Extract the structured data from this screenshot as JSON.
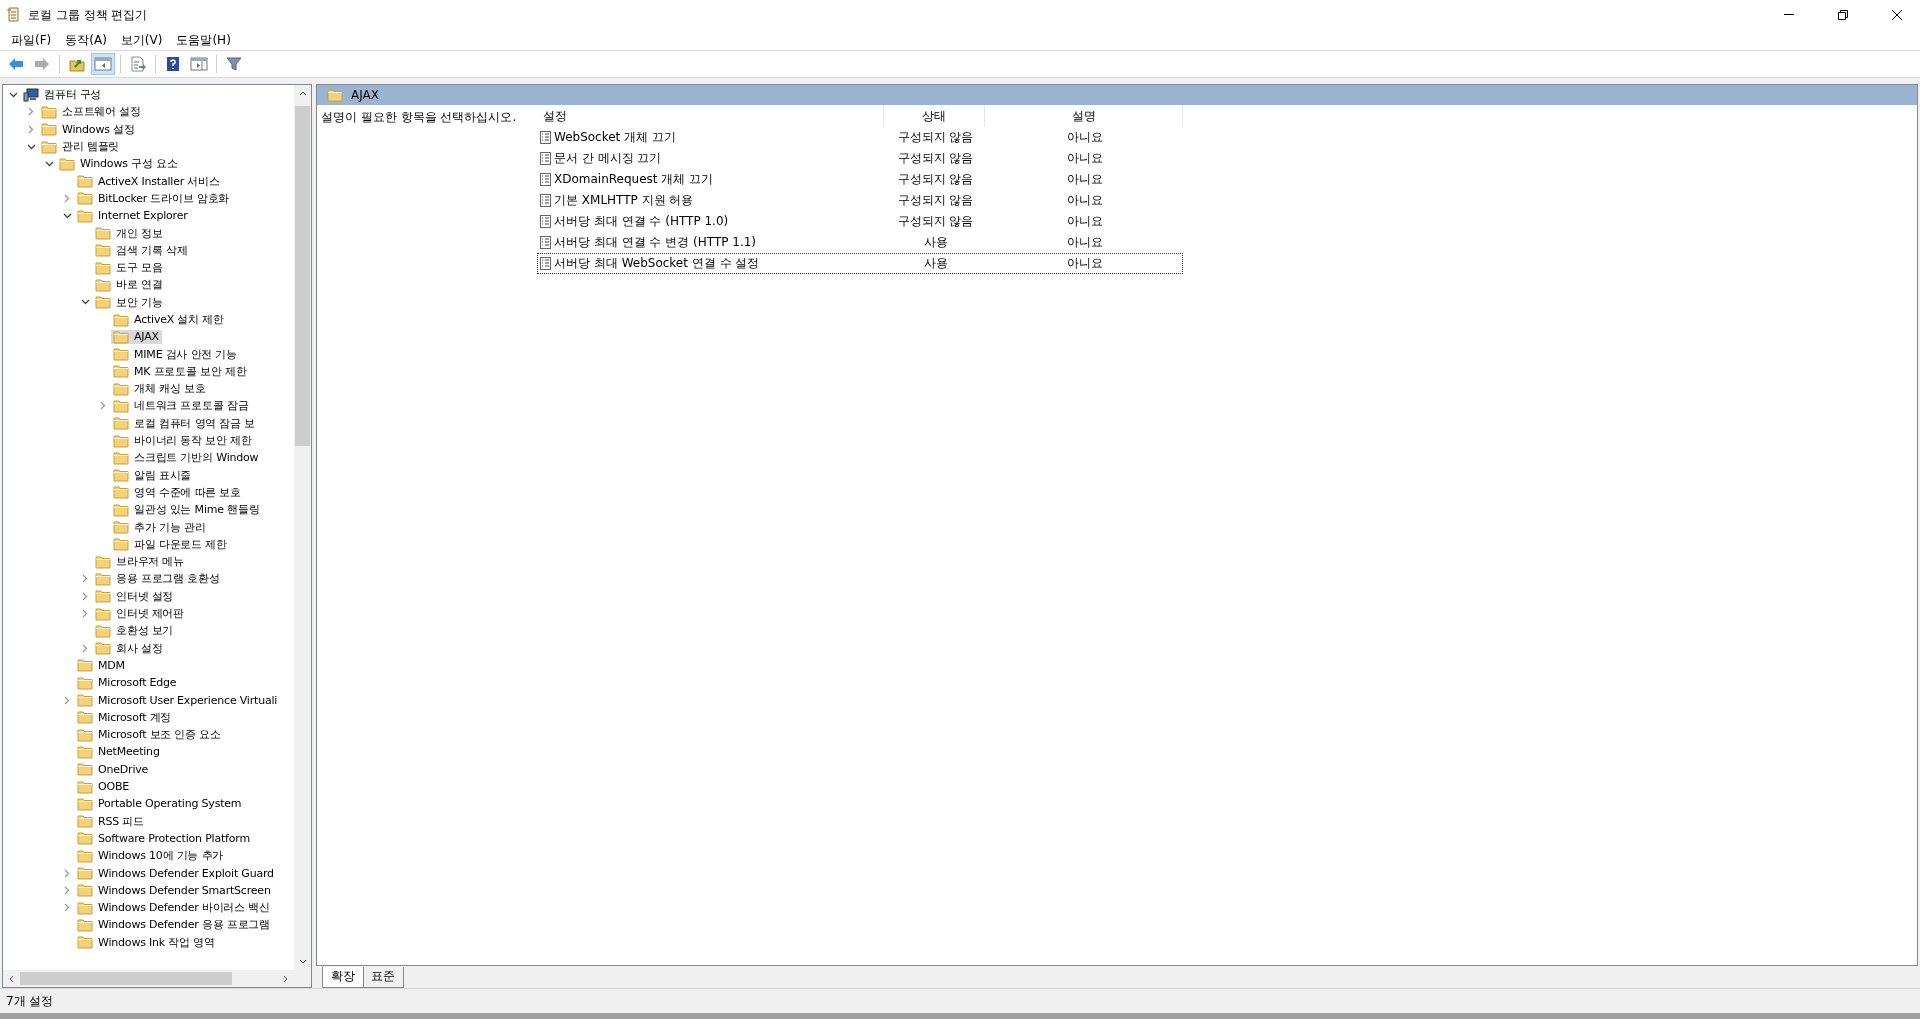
{
  "window": {
    "title": "로컬 그룹 정책 편집기"
  },
  "menu": [
    "파일(F)",
    "동작(A)",
    "보기(V)",
    "도움말(H)"
  ],
  "toolbar": [
    {
      "kind": "back",
      "disabled": false,
      "pressed": false
    },
    {
      "kind": "forward",
      "disabled": true,
      "pressed": false
    },
    {
      "kind": "up",
      "disabled": false,
      "pressed": false
    },
    {
      "kind": "tree",
      "disabled": false,
      "pressed": true
    },
    {
      "kind": "export",
      "disabled": false,
      "pressed": false
    },
    {
      "kind": "help",
      "disabled": false,
      "pressed": false
    },
    {
      "kind": "pane",
      "disabled": false,
      "pressed": false
    },
    {
      "kind": "filter",
      "disabled": false,
      "pressed": false
    }
  ],
  "tree": [
    {
      "label": "컴퓨터 구성",
      "kind": "computer",
      "expanded": true,
      "selected": false,
      "children": [
        {
          "label": "소프트웨어 설정",
          "expanded": false,
          "selected": false
        },
        {
          "label": "Windows 설정",
          "expanded": false,
          "selected": false
        },
        {
          "label": "관리 템플릿",
          "expanded": true,
          "selected": false,
          "children": [
            {
              "label": "Windows 구성 요소",
              "expanded": true,
              "selected": false,
              "children": [
                {
                  "label": "ActiveX Installer 서비스",
                  "selected": false
                },
                {
                  "label": "BitLocker 드라이브 암호화",
                  "expanded": false,
                  "selected": false
                },
                {
                  "label": "Internet Explorer",
                  "expanded": true,
                  "selected": false,
                  "children": [
                    {
                      "label": "개인 정보",
                      "selected": false
                    },
                    {
                      "label": "검색 기록 삭제",
                      "selected": false
                    },
                    {
                      "label": "도구 모음",
                      "selected": false
                    },
                    {
                      "label": "바로 연결",
                      "selected": false
                    },
                    {
                      "label": "보안 기능",
                      "expanded": true,
                      "selected": false,
                      "children": [
                        {
                          "label": "ActiveX 설치 제한",
                          "selected": false
                        },
                        {
                          "label": "AJAX",
                          "selected": true
                        },
                        {
                          "label": "MIME 검사 안전 기능",
                          "selected": false
                        },
                        {
                          "label": "MK 프로토콜 보안 제한",
                          "selected": false
                        },
                        {
                          "label": "개체 캐싱 보호",
                          "selected": false
                        },
                        {
                          "label": "네트워크 프로토콜 잠금",
                          "expanded": false,
                          "selected": false
                        },
                        {
                          "label": "로컬 컴퓨터 영역 잠금 보",
                          "selected": false
                        },
                        {
                          "label": "바이너리 동작 보안 제한",
                          "selected": false
                        },
                        {
                          "label": "스크립트 기반의 Window",
                          "selected": false
                        },
                        {
                          "label": "알림 표시줄",
                          "selected": false
                        },
                        {
                          "label": "영역 수준에 따른 보호",
                          "selected": false
                        },
                        {
                          "label": "일관성 있는 Mime 핸들링",
                          "selected": false
                        },
                        {
                          "label": "추가 기능 관리",
                          "selected": false
                        },
                        {
                          "label": "파일 다운로드 제한",
                          "selected": false
                        }
                      ]
                    },
                    {
                      "label": "브라우저 메뉴",
                      "selected": false
                    },
                    {
                      "label": "응용 프로그램 호환성",
                      "expanded": false,
                      "selected": false
                    },
                    {
                      "label": "인터넷 설정",
                      "expanded": false,
                      "selected": false
                    },
                    {
                      "label": "인터넷 제어판",
                      "expanded": false,
                      "selected": false
                    },
                    {
                      "label": "호환성 보기",
                      "selected": false
                    },
                    {
                      "label": "회사 설정",
                      "expanded": false,
                      "selected": false
                    }
                  ]
                },
                {
                  "label": "MDM",
                  "selected": false
                },
                {
                  "label": "Microsoft Edge",
                  "selected": false
                },
                {
                  "label": "Microsoft User Experience Virtuali",
                  "expanded": false,
                  "selected": false
                },
                {
                  "label": "Microsoft 계정",
                  "selected": false
                },
                {
                  "label": "Microsoft 보조 인증 요소",
                  "selected": false
                },
                {
                  "label": "NetMeeting",
                  "selected": false
                },
                {
                  "label": "OneDrive",
                  "selected": false
                },
                {
                  "label": "OOBE",
                  "selected": false
                },
                {
                  "label": "Portable Operating System",
                  "selected": false
                },
                {
                  "label": "RSS 피드",
                  "selected": false
                },
                {
                  "label": "Software Protection Platform",
                  "selected": false
                },
                {
                  "label": "Windows 10에 기능 추가",
                  "selected": false
                },
                {
                  "label": "Windows Defender Exploit Guard",
                  "expanded": false,
                  "selected": false
                },
                {
                  "label": "Windows Defender SmartScreen",
                  "expanded": false,
                  "selected": false
                },
                {
                  "label": "Windows Defender 바이러스 백신",
                  "expanded": false,
                  "selected": false
                },
                {
                  "label": "Windows Defender 응용 프로그램",
                  "selected": false
                },
                {
                  "label": "Windows Ink 작업 영역",
                  "selected": false
                }
              ]
            }
          ]
        }
      ]
    }
  ],
  "pane": {
    "title": "AJAX",
    "description": "설명이 필요한 항목을 선택하십시오.",
    "columns": [
      "설정",
      "상태",
      "설명"
    ],
    "rows": [
      {
        "name": "WebSocket 개체 끄기",
        "state": "구성되지 않음",
        "comment": "아니요",
        "focused": false
      },
      {
        "name": "문서 간 메시징 끄기",
        "state": "구성되지 않음",
        "comment": "아니요",
        "focused": false
      },
      {
        "name": "XDomainRequest 개체 끄기",
        "state": "구성되지 않음",
        "comment": "아니요",
        "focused": false
      },
      {
        "name": "기본 XMLHTTP 지원 허용",
        "state": "구성되지 않음",
        "comment": "아니요",
        "focused": false
      },
      {
        "name": "서버당 최대 연결 수 (HTTP 1.0)",
        "state": "구성되지 않음",
        "comment": "아니요",
        "focused": false
      },
      {
        "name": "서버당 최대 연결 수 변경 (HTTP 1.1)",
        "state": "사용",
        "comment": "아니요",
        "focused": false
      },
      {
        "name": "서버당 최대 WebSocket 연결 수 설정",
        "state": "사용",
        "comment": "아니요",
        "focused": true
      }
    ],
    "tabs": [
      {
        "label": "확장",
        "selected": true
      },
      {
        "label": "표준",
        "selected": false
      }
    ]
  },
  "status_bar": "7개 설정"
}
